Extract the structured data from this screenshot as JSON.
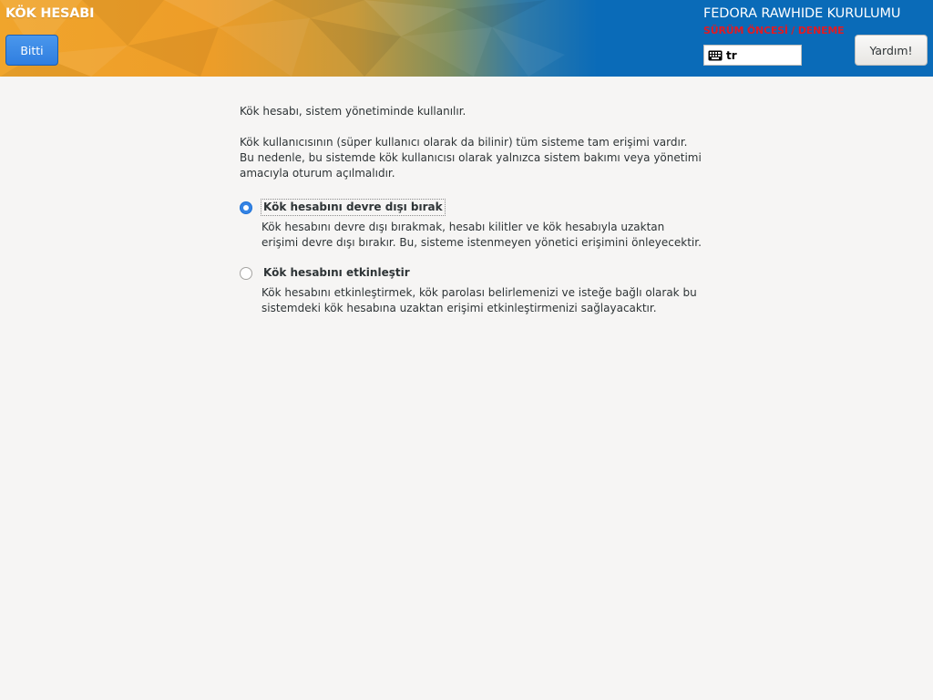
{
  "header": {
    "spoke_title": "KÖK HESABI",
    "done_label": "Bitti",
    "product_title": "FEDORA RAWHIDE KURULUMU",
    "beta_warning": "SÜRÜM ÖNCESİ / DENEME",
    "keyboard_layout": "tr",
    "help_label": "Yardım!"
  },
  "main": {
    "intro": "Kök hesabı, sistem yönetiminde kullanılır.",
    "details": "Kök kullanıcısının (süper kullanıcı olarak da bilinir) tüm sisteme tam erişimi vardır. Bu nedenle, bu sistemde kök kullanıcısı olarak yalnızca sistem bakımı veya yönetimi amacıyla oturum açılmalıdır.",
    "options": [
      {
        "label": "Kök hesabını devre dışı bırak",
        "description": "Kök hesabını devre dışı bırakmak, hesabı kilitler ve kök hesabıyla uzaktan erişimi devre dışı bırakır. Bu, sisteme istenmeyen yönetici erişimini önleyecektir.",
        "selected": true
      },
      {
        "label": "Kök hesabını etkinleştir",
        "description": "Kök hesabını etkinleştirmek, kök parolası belirlemenizi ve isteğe bağlı olarak bu sistemdeki kök hesabına uzaktan erişimi etkinleştirmenizi sağlayacaktır.",
        "selected": false
      }
    ]
  },
  "colors": {
    "header_orange": "#f0a52c",
    "header_blue": "#0a6bb8",
    "accent": "#3584e4",
    "warning_red": "#e01b24",
    "background": "#f6f5f4"
  },
  "icons": {
    "keyboard": "keyboard-icon"
  }
}
